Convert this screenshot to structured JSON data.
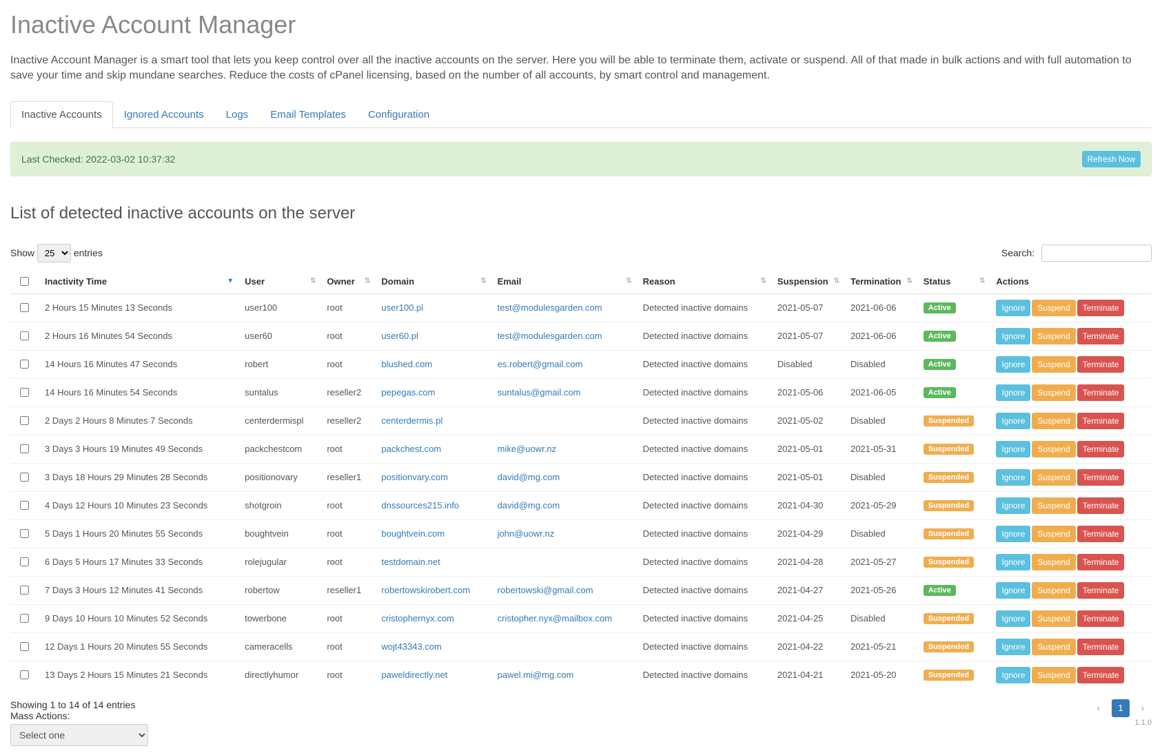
{
  "page": {
    "title": "Inactive Account Manager",
    "description": "Inactive Account Manager is a smart tool that lets you keep control over all the inactive accounts on the server. Here you will be able to terminate them, activate or suspend. All of that made in bulk actions and with full automation to save your time and skip mundane searches. Reduce the costs of cPanel licensing, based on the number of all accounts, by smart control and management."
  },
  "tabs": [
    {
      "label": "Inactive Accounts",
      "active": true
    },
    {
      "label": "Ignored Accounts",
      "active": false
    },
    {
      "label": "Logs",
      "active": false
    },
    {
      "label": "Email Templates",
      "active": false
    },
    {
      "label": "Configuration",
      "active": false
    }
  ],
  "alert": {
    "text": "Last Checked: 2022-03-02 10:37:32",
    "button": "Refresh Now"
  },
  "section_title": "List of detected inactive accounts on the server",
  "length_menu": {
    "prefix": "Show",
    "value": "25",
    "suffix": "entries"
  },
  "search": {
    "label": "Search:",
    "value": ""
  },
  "columns": [
    "Inactivity Time",
    "User",
    "Owner",
    "Domain",
    "Email",
    "Reason",
    "Suspension",
    "Termination",
    "Status",
    "Actions"
  ],
  "rows": [
    {
      "inactivity": "2 Hours 15 Minutes 13 Seconds",
      "user": "user100",
      "owner": "root",
      "domain": "user100.pl",
      "email": "test@modulesgarden.com",
      "reason": "Detected inactive domains",
      "suspension": "2021-05-07",
      "termination": "2021-06-06",
      "status": "Active"
    },
    {
      "inactivity": "2 Hours 16 Minutes 54 Seconds",
      "user": "user60",
      "owner": "root",
      "domain": "user60.pl",
      "email": "test@modulesgarden.com",
      "reason": "Detected inactive domains",
      "suspension": "2021-05-07",
      "termination": "2021-06-06",
      "status": "Active"
    },
    {
      "inactivity": "14 Hours 16 Minutes 47 Seconds",
      "user": "robert",
      "owner": "root",
      "domain": "blushed.com",
      "email": "es.robert@gmail.com",
      "reason": "Detected inactive domains",
      "suspension": "Disabled",
      "termination": "Disabled",
      "status": "Active"
    },
    {
      "inactivity": "14 Hours 16 Minutes 54 Seconds",
      "user": "suntalus",
      "owner": "reseller2",
      "domain": "pepegas.com",
      "email": "suntalus@gmail.com",
      "reason": "Detected inactive domains",
      "suspension": "2021-05-06",
      "termination": "2021-06-05",
      "status": "Active"
    },
    {
      "inactivity": "2 Days 2 Hours 8 Minutes 7 Seconds",
      "user": "centerdermispl",
      "owner": "reseller2",
      "domain": "centerdermis.pl",
      "email": "",
      "reason": "Detected inactive domains",
      "suspension": "2021-05-02",
      "termination": "Disabled",
      "status": "Suspended"
    },
    {
      "inactivity": "3 Days 3 Hours 19 Minutes 49 Seconds",
      "user": "packchestcom",
      "owner": "root",
      "domain": "packchest.com",
      "email": "mike@uowr.nz",
      "reason": "Detected inactive domains",
      "suspension": "2021-05-01",
      "termination": "2021-05-31",
      "status": "Suspended"
    },
    {
      "inactivity": "3 Days 18 Hours 29 Minutes 28 Seconds",
      "user": "positionovary",
      "owner": "reseller1",
      "domain": "positionvary.com",
      "email": "david@mg.com",
      "reason": "Detected inactive domains",
      "suspension": "2021-05-01",
      "termination": "Disabled",
      "status": "Suspended"
    },
    {
      "inactivity": "4 Days 12 Hours 10 Minutes 23 Seconds",
      "user": "shotgroin",
      "owner": "root",
      "domain": "dnssources215.info",
      "email": "david@mg.com",
      "reason": "Detected inactive domains",
      "suspension": "2021-04-30",
      "termination": "2021-05-29",
      "status": "Suspended"
    },
    {
      "inactivity": "5 Days 1 Hours 20 Minutes 55 Seconds",
      "user": "boughtvein",
      "owner": "root",
      "domain": "boughtvein.com",
      "email": "john@uowr.nz",
      "reason": "Detected inactive domains",
      "suspension": "2021-04-29",
      "termination": "Disabled",
      "status": "Suspended"
    },
    {
      "inactivity": "6 Days 5 Hours 17 Minutes 33 Seconds",
      "user": "rolejugular",
      "owner": "root",
      "domain": "testdomain.net",
      "email": "",
      "reason": "Detected inactive domains",
      "suspension": "2021-04-28",
      "termination": "2021-05-27",
      "status": "Suspended"
    },
    {
      "inactivity": "7 Days 3 Hours 12 Minutes 41 Seconds",
      "user": "robertow",
      "owner": "reseller1",
      "domain": "robertowskirobert.com",
      "email": "robertowski@gmail.com",
      "reason": "Detected inactive domains",
      "suspension": "2021-04-27",
      "termination": "2021-05-26",
      "status": "Active"
    },
    {
      "inactivity": "9 Days 10 Hours 10 Minutes 52 Seconds",
      "user": "towerbone",
      "owner": "root",
      "domain": "cristophernyx.com",
      "email": "cristopher.nyx@mailbox.com",
      "reason": "Detected inactive domains",
      "suspension": "2021-04-25",
      "termination": "Disabled",
      "status": "Suspended"
    },
    {
      "inactivity": "12 Days 1 Hours 20 Minutes 55 Seconds",
      "user": "cameracells",
      "owner": "root",
      "domain": "wojt43343.com",
      "email": "",
      "reason": "Detected inactive domains",
      "suspension": "2021-04-22",
      "termination": "2021-05-21",
      "status": "Suspended"
    },
    {
      "inactivity": "13 Days 2 Hours 15 Minutes 21 Seconds",
      "user": "directlyhumor",
      "owner": "root",
      "domain": "paweldirectly.net",
      "email": "pawel.mi@mg.com",
      "reason": "Detected inactive domains",
      "suspension": "2021-04-21",
      "termination": "2021-05-20",
      "status": "Suspended"
    }
  ],
  "action_labels": {
    "ignore": "Ignore",
    "suspend": "Suspend",
    "terminate": "Terminate"
  },
  "info": "Showing 1 to 14 of 14 entries",
  "mass_actions": {
    "label": "Mass Actions:",
    "selected": "Select one"
  },
  "pager": {
    "current": "1"
  },
  "version": "1.1.0"
}
